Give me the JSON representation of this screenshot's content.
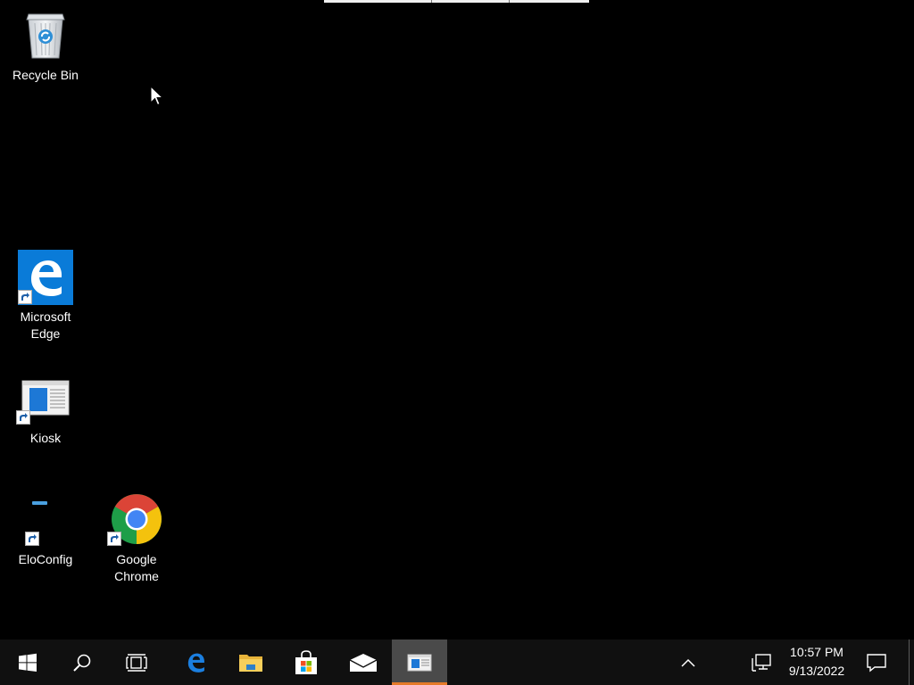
{
  "desktop": {
    "background_color": "#000000",
    "icons": [
      {
        "id": "recycle-bin",
        "label": "Recycle Bin",
        "icon": "recycle-bin-icon"
      },
      {
        "id": "microsoft-edge",
        "label": "Microsoft Edge",
        "icon": "edge-icon"
      },
      {
        "id": "kiosk",
        "label": "Kiosk",
        "icon": "kiosk-icon"
      },
      {
        "id": "eloconfig",
        "label": "EloConfig",
        "icon": "eloconfig-icon"
      },
      {
        "id": "google-chrome",
        "label": "Google Chrome",
        "icon": "chrome-icon"
      }
    ]
  },
  "taskbar": {
    "background_color": "#101010",
    "accent_color": "#e57a28",
    "buttons": [
      {
        "id": "start",
        "icon": "windows-logo-icon"
      },
      {
        "id": "search",
        "icon": "search-icon"
      },
      {
        "id": "task-view",
        "icon": "task-view-icon"
      },
      {
        "id": "edge",
        "icon": "edge-icon"
      },
      {
        "id": "file-explorer",
        "icon": "folder-icon"
      },
      {
        "id": "microsoft-store",
        "icon": "store-bag-icon"
      },
      {
        "id": "mail",
        "icon": "mail-icon"
      },
      {
        "id": "kiosk",
        "icon": "kiosk-icon",
        "active": true
      }
    ],
    "tray": {
      "overflow_icon": "chevron-up-icon",
      "network_icon": "network-icon",
      "time": "10:57 PM",
      "date": "9/13/2022",
      "notification_icon": "action-center-icon"
    }
  }
}
